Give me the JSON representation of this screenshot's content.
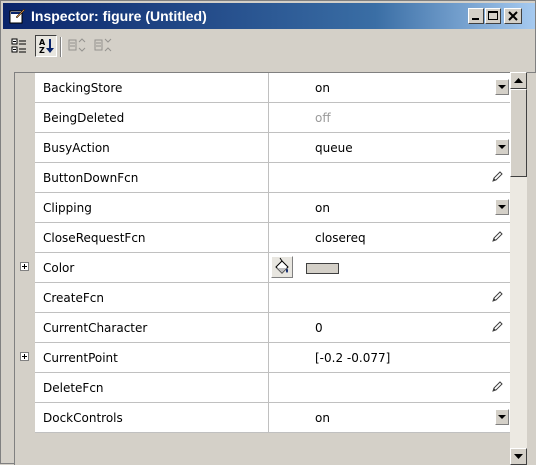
{
  "window": {
    "title": "Inspector: figure (Untitled)"
  },
  "toolbar": {
    "buttons": [
      {
        "icon": "categorized-icon",
        "pressed": false
      },
      {
        "icon": "sort-alphabetically-icon",
        "pressed": true
      },
      {
        "icon": "expand-all-icon",
        "enabled": false
      },
      {
        "icon": "collapse-all-icon",
        "enabled": false
      }
    ]
  },
  "properties": [
    {
      "name": "BackingStore",
      "value": "on",
      "editor": "dropdown"
    },
    {
      "name": "BeingDeleted",
      "value": "off",
      "editor": "readonly"
    },
    {
      "name": "BusyAction",
      "value": "queue",
      "editor": "dropdown"
    },
    {
      "name": "ButtonDownFcn",
      "value": "",
      "editor": "pencil"
    },
    {
      "name": "Clipping",
      "value": "on",
      "editor": "dropdown"
    },
    {
      "name": "CloseRequestFcn",
      "value": "closereq",
      "editor": "pencil"
    },
    {
      "name": "Color",
      "value": "",
      "editor": "color",
      "expandable": true,
      "color": "#d4d0c8"
    },
    {
      "name": "CreateFcn",
      "value": "",
      "editor": "pencil"
    },
    {
      "name": "CurrentCharacter",
      "value": "0",
      "editor": "pencil"
    },
    {
      "name": "CurrentPoint",
      "value": "[-0.2 -0.077]",
      "editor": "none",
      "expandable": true
    },
    {
      "name": "DeleteFcn",
      "value": "",
      "editor": "pencil"
    },
    {
      "name": "DockControls",
      "value": "on",
      "editor": "dropdown"
    }
  ]
}
